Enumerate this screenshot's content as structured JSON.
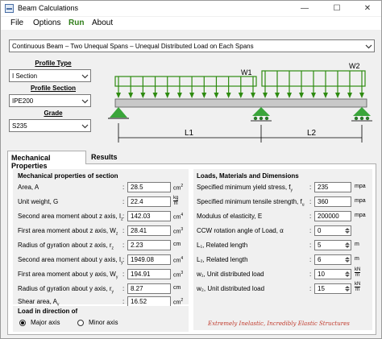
{
  "window": {
    "title": "Beam Calculations",
    "minimize": "—",
    "maximize": "☐",
    "close": "✕"
  },
  "menu": {
    "file": "File",
    "options": "Options",
    "run": "Run",
    "about": "About"
  },
  "beam_type": "Continuous Beam – Two Unequal Spans – Unequal Distributed Load on Each Spans",
  "left": {
    "profile_type_label": "Profile Type",
    "profile_type_value": "I Section",
    "profile_section_label": "Profile Section",
    "profile_section_value": "IPE200",
    "grade_label": "Grade",
    "grade_value": "S235"
  },
  "diagram": {
    "w1": "W1",
    "w2": "W2",
    "l1": "L1",
    "l2": "L2"
  },
  "tabs": {
    "mechanical": "Mechanical Properties",
    "results": "Results"
  },
  "mech": {
    "title": "Mechanical properties of section",
    "rows": [
      {
        "label": "Area, A",
        "value": "28.5",
        "unit": "cm",
        "sup": "2"
      },
      {
        "label": "Unit weight, G",
        "value": "22.4",
        "unit_top": "kg",
        "unit_bottom": "m"
      },
      {
        "label": "Second area moment about z axis, I",
        "sub": "z",
        "value": "142.03",
        "unit": "cm",
        "sup": "4"
      },
      {
        "label": "First area moment about z axis, W",
        "sub": "z",
        "value": "28.41",
        "unit": "cm",
        "sup": "3"
      },
      {
        "label": "Radius of gyration about z axis, r",
        "sub": "z",
        "value": "2.23",
        "unit": "cm"
      },
      {
        "label": "Second area moment about y axis, I",
        "sub": "y",
        "value": "1949.08",
        "unit": "cm",
        "sup": "4"
      },
      {
        "label": "First area moment about y axis, W",
        "sub": "y",
        "value": "194.91",
        "unit": "cm",
        "sup": "3"
      },
      {
        "label": "Radius of gyration about y axis, r",
        "sub": "y",
        "value": "8.27",
        "unit": "cm"
      },
      {
        "label": "Shear area, A",
        "sub": "v",
        "value": "16.52",
        "unit": "cm",
        "sup": "2"
      }
    ]
  },
  "loads": {
    "title": "Loads, Materials and Dimensions",
    "rows": [
      {
        "label": "Specified minimum yield stress, f",
        "sub": "y",
        "value": "235",
        "unit": "mpa"
      },
      {
        "label": "Specified minimum tensile strength, f",
        "sub": "u",
        "value": "360",
        "unit": "mpa"
      },
      {
        "label": "Modulus of elasticity, E",
        "value": "200000",
        "unit": "mpa"
      },
      {
        "label": "CCW rotation angle of Load, α",
        "value": "0",
        "unit": ""
      },
      {
        "label": "L₁, Related length",
        "value": "5",
        "unit": "m"
      },
      {
        "label": "L₂, Related length",
        "value": "6",
        "unit": "m"
      },
      {
        "label": "w₁, Unit distributed load",
        "value": "10",
        "unit_top": "kN",
        "unit_bottom": "m"
      },
      {
        "label": "w₂, Unit distributed load",
        "value": "15",
        "unit_top": "kN",
        "unit_bottom": "m"
      }
    ]
  },
  "load_direction": {
    "title": "Load in direction of",
    "major": "Major axis",
    "minor": "Minor axis",
    "selected": "major"
  },
  "tagline": "Extremely Inelastic, Incredibly Elastic Structures",
  "colors": {
    "beam_fill": "#c8c8c8",
    "load_arrow": "#2e8b10",
    "support": "#3aa53a",
    "tagline": "#c0392b"
  }
}
